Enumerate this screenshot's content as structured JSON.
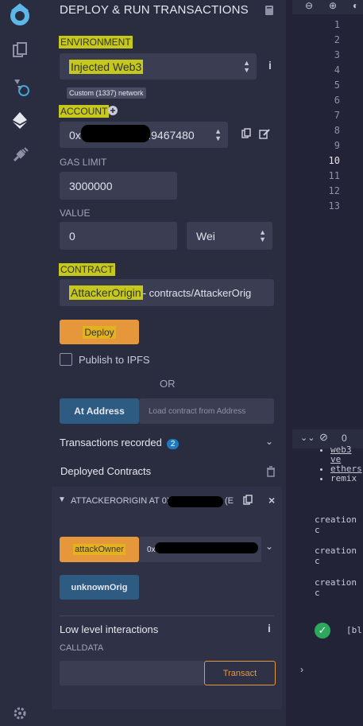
{
  "panel": {
    "title": "DEPLOY & RUN TRANSACTIONS",
    "environment_label": "ENVIRONMENT",
    "environment_value": "Injected Web3",
    "network_badge": "Custom (1337) network",
    "account_label": "ACCOUNT",
    "account_value_prefix": "0x",
    "account_value_suffix": "(9.9467480",
    "gas_limit_label": "GAS LIMIT",
    "gas_limit_value": "3000000",
    "value_label": "VALUE",
    "value_amount": "0",
    "value_unit": "Wei",
    "contract_label": "CONTRACT",
    "contract_name": "AttackerOrigin",
    "contract_path": " - contracts/AttackerOrig",
    "deploy_button": "Deploy",
    "publish_ipfs": "Publish to IPFS",
    "or_text": "OR",
    "at_address_button": "At Address",
    "load_contract_placeholder": "Load contract from Address",
    "transactions_recorded": "Transactions recorded",
    "transactions_count": "2",
    "deployed_contracts": "Deployed Contracts",
    "instance_title": "ATTACKERORIGIN AT 0X",
    "instance_suffix": "(E",
    "attack_owner_button": "attackOwner",
    "attack_owner_input_prefix": "0x",
    "unknown_orig_button": "unknownOrig",
    "low_level_interactions": "Low level interactions",
    "calldata_label": "CALLDATA",
    "transact_button": "Transact"
  },
  "icons": {
    "logo": "remix-logo-icon",
    "file_explorer": "file-explorer-icon",
    "compiler": "solidity-compiler-icon",
    "deploy": "ethereum-icon",
    "plugin": "plugin-icon",
    "settings": "gear-icon"
  },
  "editor": {
    "line_numbers": [
      "1",
      "2",
      "3",
      "4",
      "5",
      "6",
      "7",
      "8",
      "9",
      "10",
      "11",
      "12",
      "13"
    ],
    "terminal_count": "0",
    "terminal_links": [
      "web3 ve",
      "ethers",
      "remix"
    ],
    "terminal_lines": [
      "creation c",
      "creation c",
      "creation c"
    ],
    "terminal_bl": "[bl"
  },
  "colors": {
    "accent_orange": "#e7973b",
    "accent_blue": "#2d5b82",
    "highlight_yellow": "#c6c91b"
  }
}
